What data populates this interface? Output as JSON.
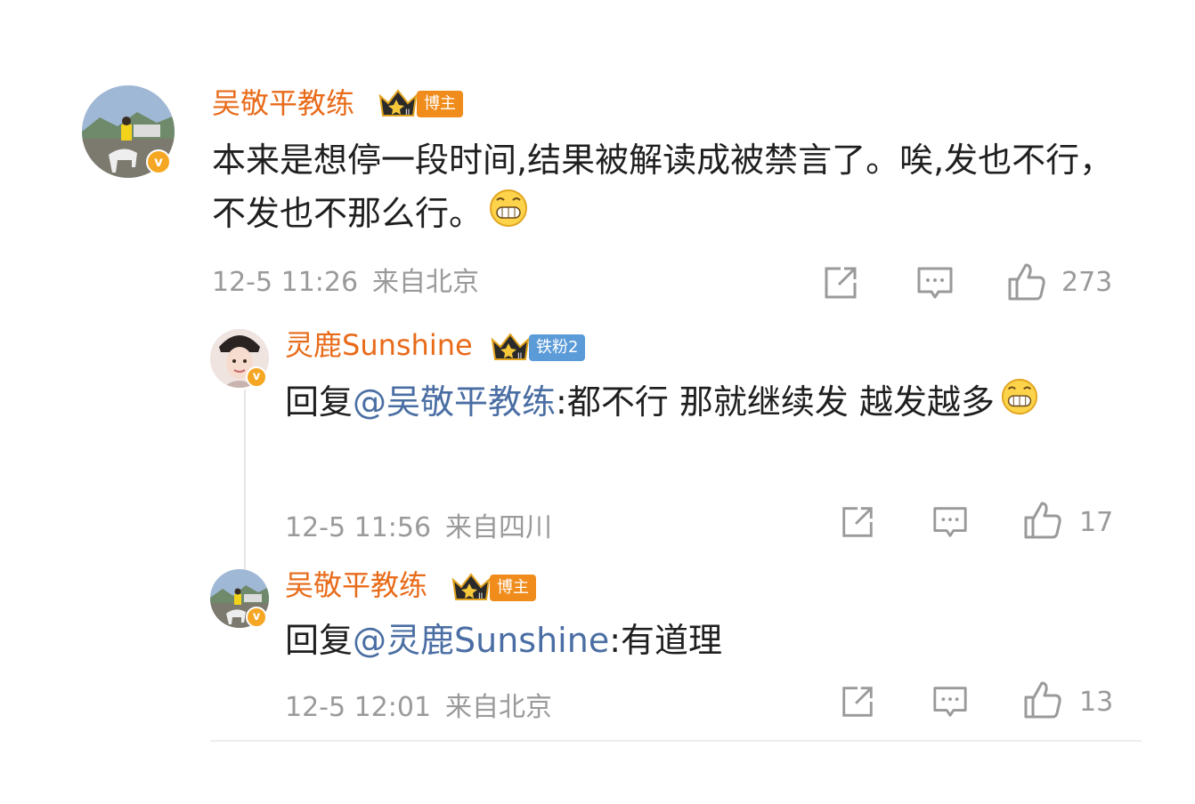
{
  "comments": [
    {
      "author": "吴敬平教练",
      "badge": "博主",
      "text": "本来是想停一段时间,结果被解读成被禁言了。唉,发也不行，不发也不那么行。",
      "emoji": "grin-emoji",
      "time": "12-5 11:26",
      "location": "来自北京",
      "likes": "273"
    },
    {
      "author": "灵鹿Sunshine",
      "badge": "铁粉2",
      "reply_prefix": "回复",
      "mention": "@吴敬平教练",
      "text": ":都不行 那就继续发 越发越多",
      "emoji": "grin-emoji",
      "time": "12-5 11:56",
      "location": "来自四川",
      "likes": "17"
    },
    {
      "author": "吴敬平教练",
      "badge": "博主",
      "reply_prefix": "回复",
      "mention": "@灵鹿Sunshine",
      "text": ":有道理",
      "time": "12-5 12:01",
      "location": "来自北京",
      "likes": "13"
    }
  ],
  "colors": {
    "name": "#e86b1a",
    "mention": "#4a6ea3",
    "meta": "#9a9a9a",
    "badge_orange": "#f08c1c",
    "badge_blue": "#5b9bd8",
    "verified": "#f5a623"
  },
  "icons": [
    "share-icon",
    "comment-icon",
    "like-icon",
    "crown-icon",
    "verified-icon"
  ]
}
